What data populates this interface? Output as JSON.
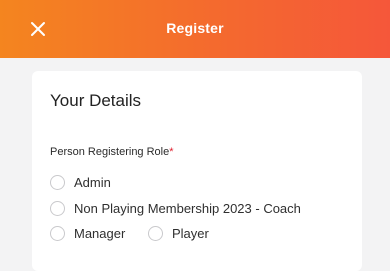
{
  "header": {
    "title": "Register",
    "close_icon": "close-icon",
    "gradient_colors": [
      "#f4851f",
      "#f5573a"
    ]
  },
  "details": {
    "section_title": "Your Details",
    "role_field": {
      "label": "Person Registering Role",
      "required_marker": "*",
      "options": [
        "Admin",
        "Non Playing Membership 2023 - Coach",
        "Manager",
        "Player"
      ],
      "selected": null
    }
  }
}
